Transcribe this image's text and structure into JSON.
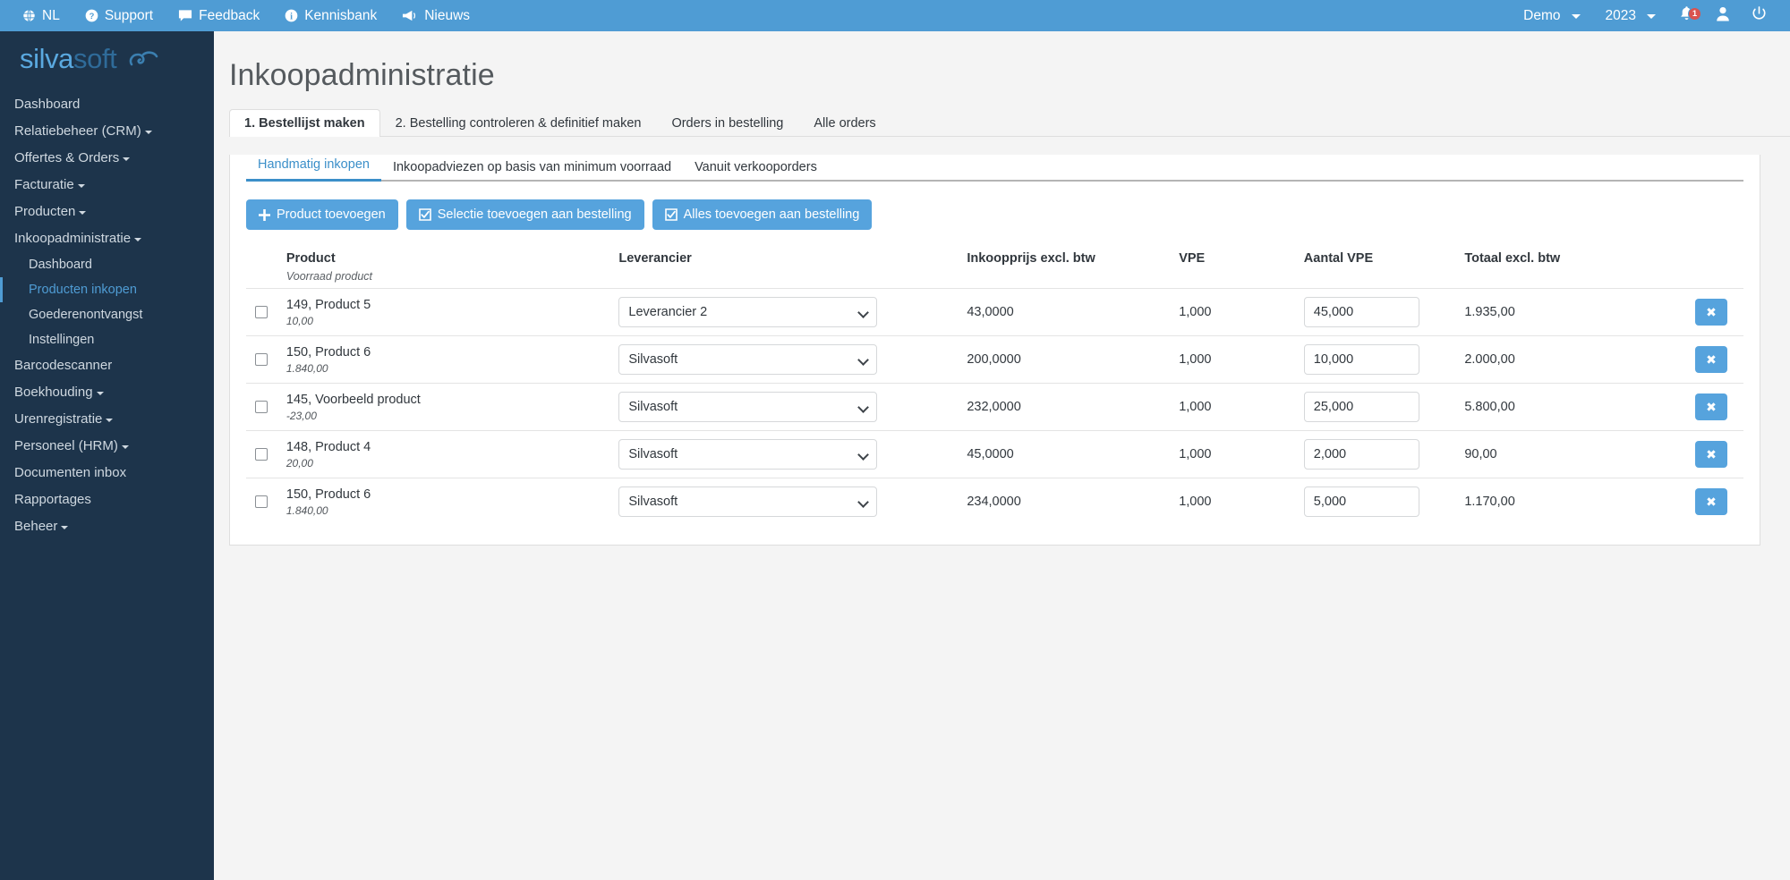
{
  "topbar": {
    "left_items": [
      {
        "label": "NL",
        "icon": "globe-icon"
      },
      {
        "label": "Support",
        "icon": "question-circle-icon"
      },
      {
        "label": "Feedback",
        "icon": "comment-icon"
      },
      {
        "label": "Kennisbank",
        "icon": "info-circle-icon"
      },
      {
        "label": "Nieuws",
        "icon": "megaphone-icon"
      }
    ],
    "company": "Demo",
    "year": "2023",
    "notification_count": "1",
    "accent": "#4f9cd4",
    "badge_color": "#d9534f"
  },
  "sidebar": {
    "logo": {
      "part1": "silva",
      "part2": "soft"
    },
    "items": [
      {
        "label": "Dashboard",
        "caret": false
      },
      {
        "label": "Relatiebeheer (CRM)",
        "caret": true
      },
      {
        "label": "Offertes & Orders",
        "caret": true
      },
      {
        "label": "Facturatie",
        "caret": true
      },
      {
        "label": "Producten",
        "caret": true
      },
      {
        "label": "Inkoopadministratie",
        "caret": true
      }
    ],
    "sub_items": [
      {
        "label": "Dashboard",
        "active": false
      },
      {
        "label": "Producten inkopen",
        "active": true
      },
      {
        "label": "Goederenontvangst",
        "active": false
      },
      {
        "label": "Instellingen",
        "active": false
      }
    ],
    "items_after": [
      {
        "label": "Barcodescanner",
        "caret": false
      },
      {
        "label": "Boekhouding",
        "caret": true
      },
      {
        "label": "Urenregistratie",
        "caret": true
      },
      {
        "label": "Personeel (HRM)",
        "caret": true
      },
      {
        "label": "Documenten inbox",
        "caret": false
      },
      {
        "label": "Rapportages",
        "caret": false
      },
      {
        "label": "Beheer",
        "caret": true
      }
    ],
    "active_color": "#4f9cd4"
  },
  "main": {
    "page_title": "Inkoopadministratie",
    "tabs": [
      {
        "label": "1. Bestellijst maken",
        "active": true
      },
      {
        "label": "2. Bestelling controleren & definitief maken",
        "active": false
      },
      {
        "label": "Orders in bestelling",
        "active": false
      },
      {
        "label": "Alle orders",
        "active": false
      }
    ],
    "subtabs": [
      {
        "label": "Handmatig inkopen",
        "active": true
      },
      {
        "label": "Inkoopadviezen op basis van minimum voorraad",
        "active": false
      },
      {
        "label": "Vanuit verkooporders",
        "active": false
      }
    ],
    "buttons": [
      {
        "label": "Product toevoegen",
        "icon": "plus-icon"
      },
      {
        "label": "Selectie toevoegen aan bestelling",
        "icon": "check-square-icon"
      },
      {
        "label": "Alles toevoegen aan bestelling",
        "icon": "check-square-icon"
      }
    ],
    "table": {
      "headers": {
        "product": "Product",
        "product_sub": "Voorraad product",
        "leverancier": "Leverancier",
        "inkoopprijs": "Inkoopprijs excl. btw",
        "vpe": "VPE",
        "aantal_vpe": "Aantal VPE",
        "totaal": "Totaal excl. btw"
      },
      "supplier_options": [
        "Silvasoft",
        "Leverancier 2"
      ],
      "delete_icon": "close-x-icon",
      "rows": [
        {
          "checked": false,
          "product": "149, Product 5",
          "stock": "10,00",
          "supplier": "Leverancier 2",
          "price": "43,0000",
          "vpe": "1,000",
          "aantal": "45,000",
          "totaal": "1.935,00"
        },
        {
          "checked": false,
          "product": "150, Product 6",
          "stock": "1.840,00",
          "supplier": "Silvasoft",
          "price": "200,0000",
          "vpe": "1,000",
          "aantal": "10,000",
          "totaal": "2.000,00"
        },
        {
          "checked": false,
          "product": "145, Voorbeeld product",
          "stock": "-23,00",
          "supplier": "Silvasoft",
          "price": "232,0000",
          "vpe": "1,000",
          "aantal": "25,000",
          "totaal": "5.800,00"
        },
        {
          "checked": false,
          "product": "148, Product 4",
          "stock": "20,00",
          "supplier": "Silvasoft",
          "price": "45,0000",
          "vpe": "1,000",
          "aantal": "2,000",
          "totaal": "90,00"
        },
        {
          "checked": false,
          "product": "150, Product 6",
          "stock": "1.840,00",
          "supplier": "Silvasoft",
          "price": "234,0000",
          "vpe": "1,000",
          "aantal": "5,000",
          "totaal": "1.170,00"
        }
      ]
    }
  }
}
